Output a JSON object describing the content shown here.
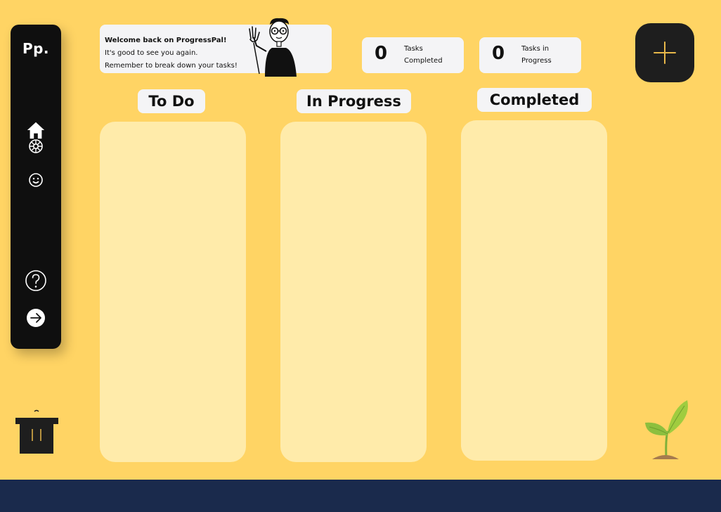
{
  "sidebar": {
    "logo": "Pp.",
    "items": [
      {
        "icon": "home-icon"
      },
      {
        "icon": "settings-icon"
      },
      {
        "icon": "smiley-icon"
      },
      {
        "icon": "help-icon"
      },
      {
        "icon": "logout-arrow-icon"
      }
    ]
  },
  "welcome": {
    "title": "Welcome back on ProgressPal!",
    "line1": "It's good to see you again.",
    "line2": "Remember to break down your tasks!"
  },
  "stats": {
    "completed": {
      "value": "0",
      "label": "Tasks Completed"
    },
    "in_progress": {
      "value": "0",
      "label": "Tasks in Progress"
    }
  },
  "board": {
    "columns": [
      {
        "title": "To Do"
      },
      {
        "title": "In Progress"
      },
      {
        "title": "Completed"
      }
    ]
  },
  "colors": {
    "background": "#FFD464",
    "sidebar": "#0F0F0F",
    "column": "#FFEBAA",
    "footer": "#1A2A4C",
    "add_plus": "#E8B84A"
  }
}
